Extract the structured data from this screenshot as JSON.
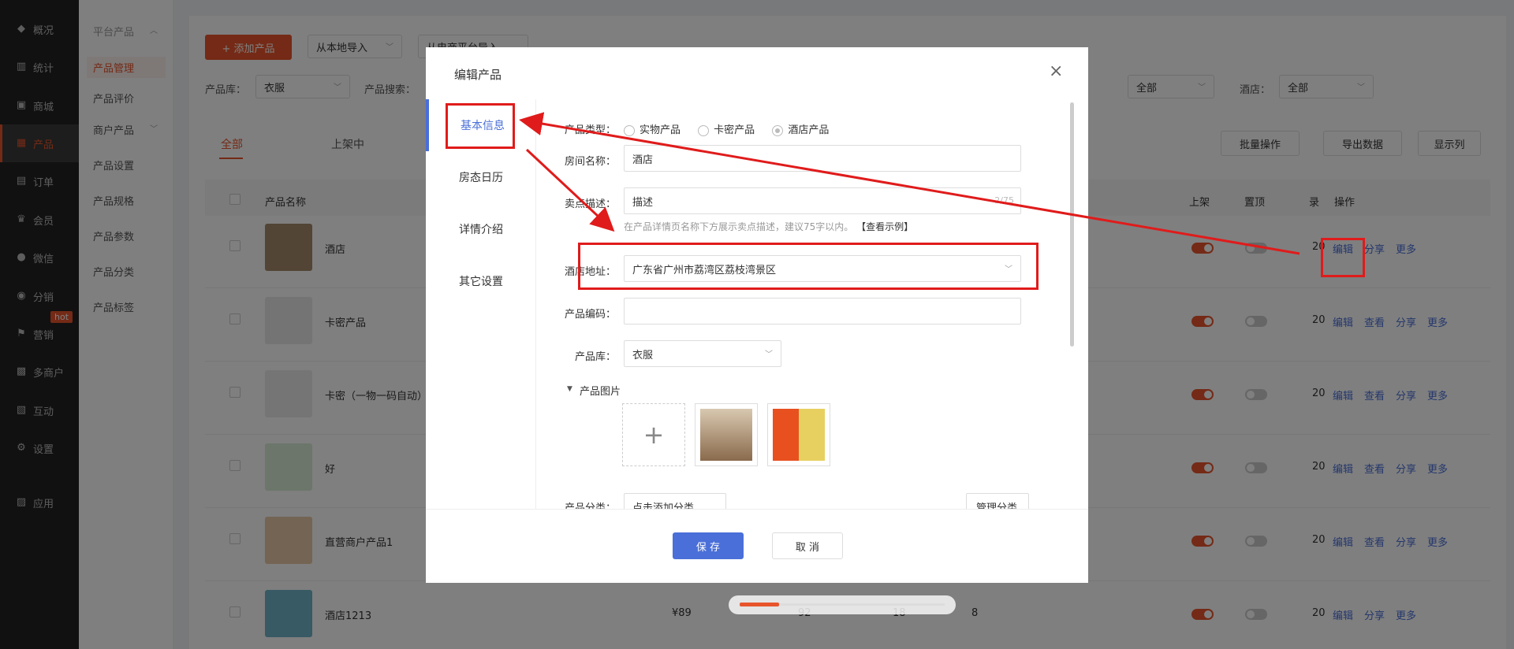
{
  "nav": {
    "items": [
      {
        "label": "概况",
        "icon": "overview-icon",
        "glyph": "◆"
      },
      {
        "label": "统计",
        "icon": "chart-icon",
        "glyph": "▥"
      },
      {
        "label": "商城",
        "icon": "store-icon",
        "glyph": "▣"
      },
      {
        "label": "产品",
        "icon": "product-icon",
        "glyph": "▦"
      },
      {
        "label": "订单",
        "icon": "order-icon",
        "glyph": "▤"
      },
      {
        "label": "会员",
        "icon": "crown-icon",
        "glyph": "♛"
      },
      {
        "label": "微信",
        "icon": "wechat-icon",
        "glyph": "●"
      },
      {
        "label": "分销",
        "icon": "distribution-icon",
        "glyph": "◉"
      },
      {
        "label": "营销",
        "icon": "flag-icon",
        "glyph": "⚑"
      },
      {
        "label": "多商户",
        "icon": "multi-merchant-icon",
        "glyph": "▩"
      },
      {
        "label": "互动",
        "icon": "interact-icon",
        "glyph": "▧"
      },
      {
        "label": "设置",
        "icon": "gear-icon",
        "glyph": "⚙"
      },
      {
        "label": "应用",
        "icon": "apps-icon",
        "glyph": "▨"
      }
    ],
    "hot_badge": "hot"
  },
  "subnav": {
    "group1": "平台产品",
    "items1": [
      "产品管理",
      "产品评价"
    ],
    "group2": "商户产品",
    "items2": [
      "产品设置",
      "产品规格",
      "产品参数",
      "产品分类",
      "产品标签"
    ]
  },
  "toolbar": {
    "add_button": "+ 添加产品",
    "import_local": "从本地导入",
    "import_platform": "从电商平台导入",
    "lib_label": "产品库：",
    "lib_value": "衣服",
    "search_label": "产品搜索：",
    "filter_all_1": "全部",
    "hotel_label": "酒店：",
    "filter_all_2": "全部"
  },
  "tabs": {
    "all": "全部",
    "on_shelf": "上架中"
  },
  "actions": {
    "batch": "批量操作",
    "export": "导出数据",
    "columns": "显示列"
  },
  "table": {
    "headers": {
      "name": "产品名称",
      "shelf": "上架",
      "top": "置顶",
      "col3": "录",
      "ops": "操作"
    },
    "rows": [
      {
        "name": "酒店",
        "shelf": true,
        "ops": [
          "编辑",
          "分享",
          "更多"
        ],
        "thumb": "#a58a6a"
      },
      {
        "name": "卡密产品",
        "shelf": true,
        "ops": [
          "编辑",
          "查看",
          "分享",
          "更多"
        ],
        "thumb": "#e8e8e8"
      },
      {
        "name": "卡密（一物一码自动）",
        "shelf": true,
        "ops": [
          "编辑",
          "查看",
          "分享",
          "更多"
        ],
        "thumb": "#eaeaea"
      },
      {
        "name": "好",
        "shelf": true,
        "ops": [
          "编辑",
          "查看",
          "分享",
          "更多"
        ],
        "thumb": "#d8ecd6"
      },
      {
        "name": "直营商户产品1",
        "shelf": true,
        "ops": [
          "编辑",
          "查看",
          "分享",
          "更多"
        ],
        "thumb": "#e9c9a6"
      },
      {
        "name": "酒店1213",
        "shelf": true,
        "ops": [
          "编辑",
          "分享",
          "更多"
        ],
        "thumb": "#6fb5c8",
        "price": "¥89",
        "c1": "92",
        "c2": "18",
        "c3": "8"
      }
    ],
    "col3_prefix": "20"
  },
  "modal": {
    "title": "编辑产品",
    "close": "×",
    "tabs": [
      "基本信息",
      "房态日历",
      "详情介绍",
      "其它设置"
    ],
    "fields": {
      "type_label": "产品类型：",
      "type_options": [
        "实物产品",
        "卡密产品",
        "酒店产品"
      ],
      "room_label": "房间名称：",
      "room_value": "酒店",
      "selling_label": "卖点描述：",
      "selling_value": "描述",
      "selling_count": "2/75",
      "selling_hint": "在产品详情页名称下方展示卖点描述，建议75字以内。",
      "selling_example": "【查看示例】",
      "address_label": "酒店地址：",
      "address_value": "广东省广州市荔湾区荔枝湾景区",
      "code_label": "产品编码：",
      "code_value": "",
      "lib_label": "产品库：",
      "lib_value": "衣服",
      "images_label": "产品图片",
      "category_label": "产品分类：",
      "category_btn": "点击添加分类",
      "manage_category": "管理分类"
    },
    "save": "保 存",
    "cancel": "取 消"
  },
  "colors": {
    "accent": "#e8542c",
    "link": "#4a6fd8",
    "annotation": "#e01b1b",
    "save_btn": "#4a6fd8"
  }
}
